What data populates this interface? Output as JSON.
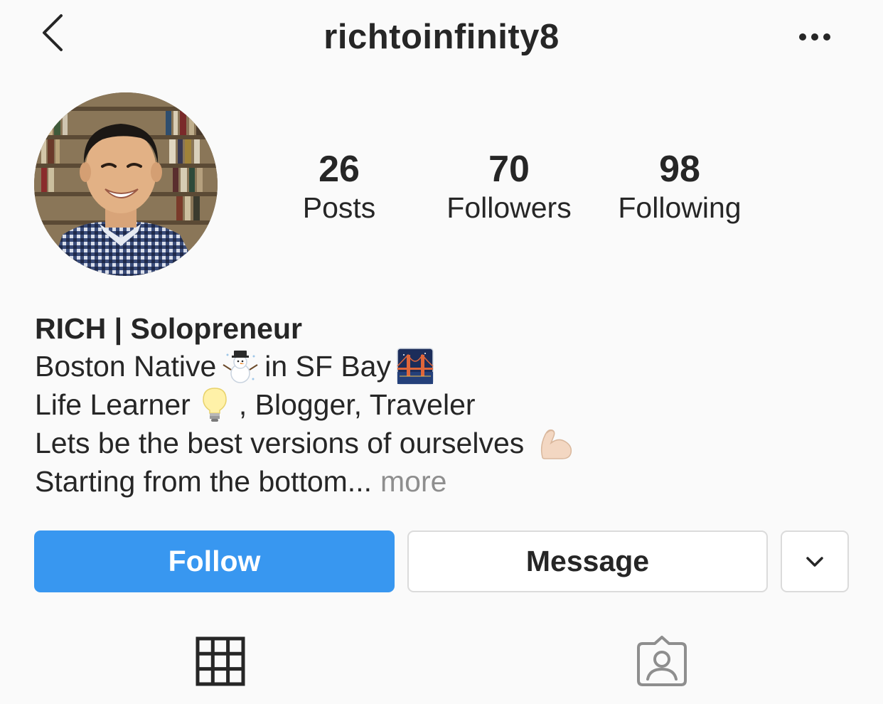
{
  "header": {
    "username": "richtoinfinity8",
    "back_icon": "chevron-left-icon",
    "more_icon": "ellipsis-icon"
  },
  "profile": {
    "avatar": "profile-photo"
  },
  "stats": {
    "posts": {
      "value": "26",
      "label": "Posts"
    },
    "followers": {
      "value": "70",
      "label": "Followers"
    },
    "following": {
      "value": "98",
      "label": "Following"
    }
  },
  "bio": {
    "name": "RICH | Solopreneur",
    "line1_a": "Boston Native",
    "line1_b": "in SF Bay",
    "line2_a": "Life Learner",
    "line2_b": ", Blogger, Traveler",
    "line3": "Lets be the best versions of ourselves",
    "line4": "Starting from the bottom...",
    "more_label": "more",
    "emojis": [
      "snowman-emoji",
      "bridge-at-night-emoji",
      "light-bulb-emoji",
      "flexed-biceps-emoji"
    ]
  },
  "actions": {
    "follow_label": "Follow",
    "message_label": "Message",
    "dropdown_icon": "chevron-down-icon"
  },
  "tabs": {
    "grid_icon": "grid-icon",
    "tagged_icon": "tagged-person-icon"
  },
  "colors": {
    "accent": "#3897f0",
    "background": "#fafafa",
    "text": "#262626",
    "muted": "#8e8e8e",
    "border": "#dbdbdb"
  }
}
